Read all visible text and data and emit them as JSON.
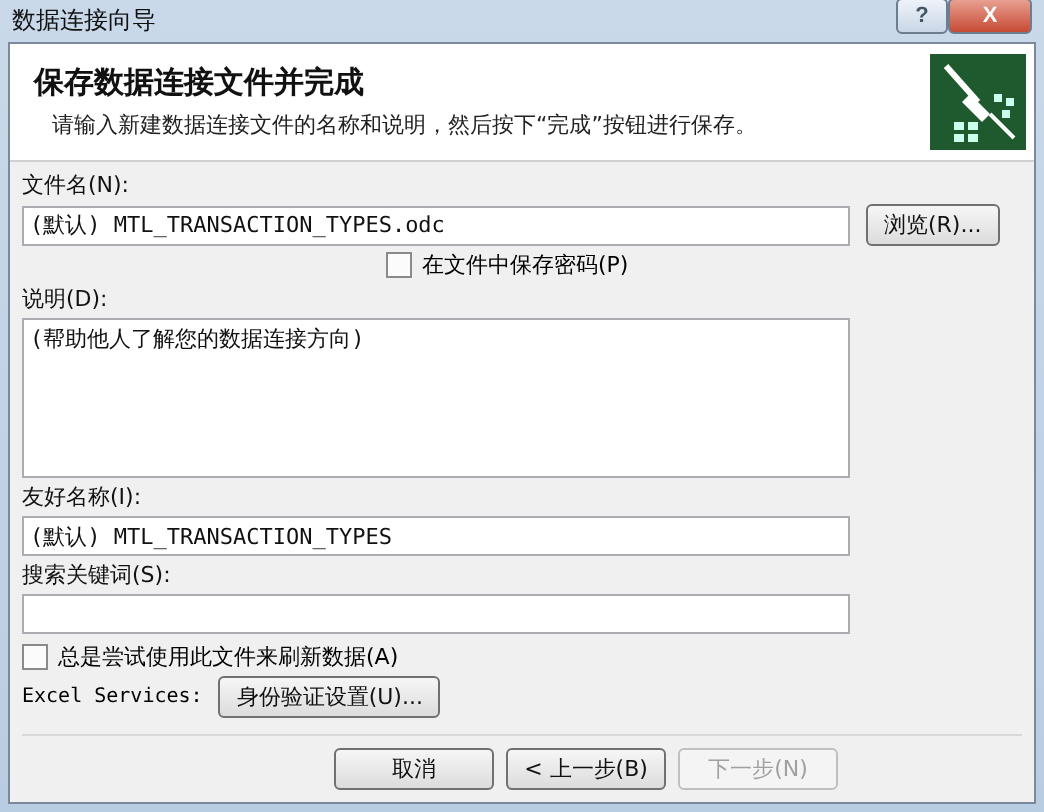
{
  "window": {
    "title": "数据连接向导",
    "buttons": [
      {
        "kind": "help",
        "label": "?"
      },
      {
        "kind": "close",
        "label": "X"
      }
    ]
  },
  "header": {
    "title": "保存数据连接文件并完成",
    "subtitle": "请输入新建数据连接文件的名称和说明，然后按下“完成”按钮进行保存。"
  },
  "file_name": {
    "label": "文件名(N):",
    "value": "(默认) MTL_TRANSACTION_TYPES.odc",
    "browse": "浏览(R)..."
  },
  "save_password": {
    "label": "在文件中保存密码(P)",
    "checked": false
  },
  "description": {
    "label": "说明(D):",
    "placeholder": "(帮助他人了解您的数据连接方向)"
  },
  "friendly_name": {
    "label": "友好名称(I):",
    "value": "(默认) MTL_TRANSACTION_TYPES"
  },
  "keywords": {
    "label": "搜索关键词(S):"
  },
  "always_refresh": {
    "label": "总是尝试使用此文件来刷新数据(A)",
    "checked": false
  },
  "excel_services": {
    "label": "Excel Services:",
    "button": "身份验证设置(U)..."
  },
  "footer_buttons": [
    {
      "label": "取消",
      "disabled": false
    },
    {
      "label": "< 上一步(B)",
      "disabled": false
    },
    {
      "label": "下一步(N)",
      "disabled": true
    }
  ]
}
